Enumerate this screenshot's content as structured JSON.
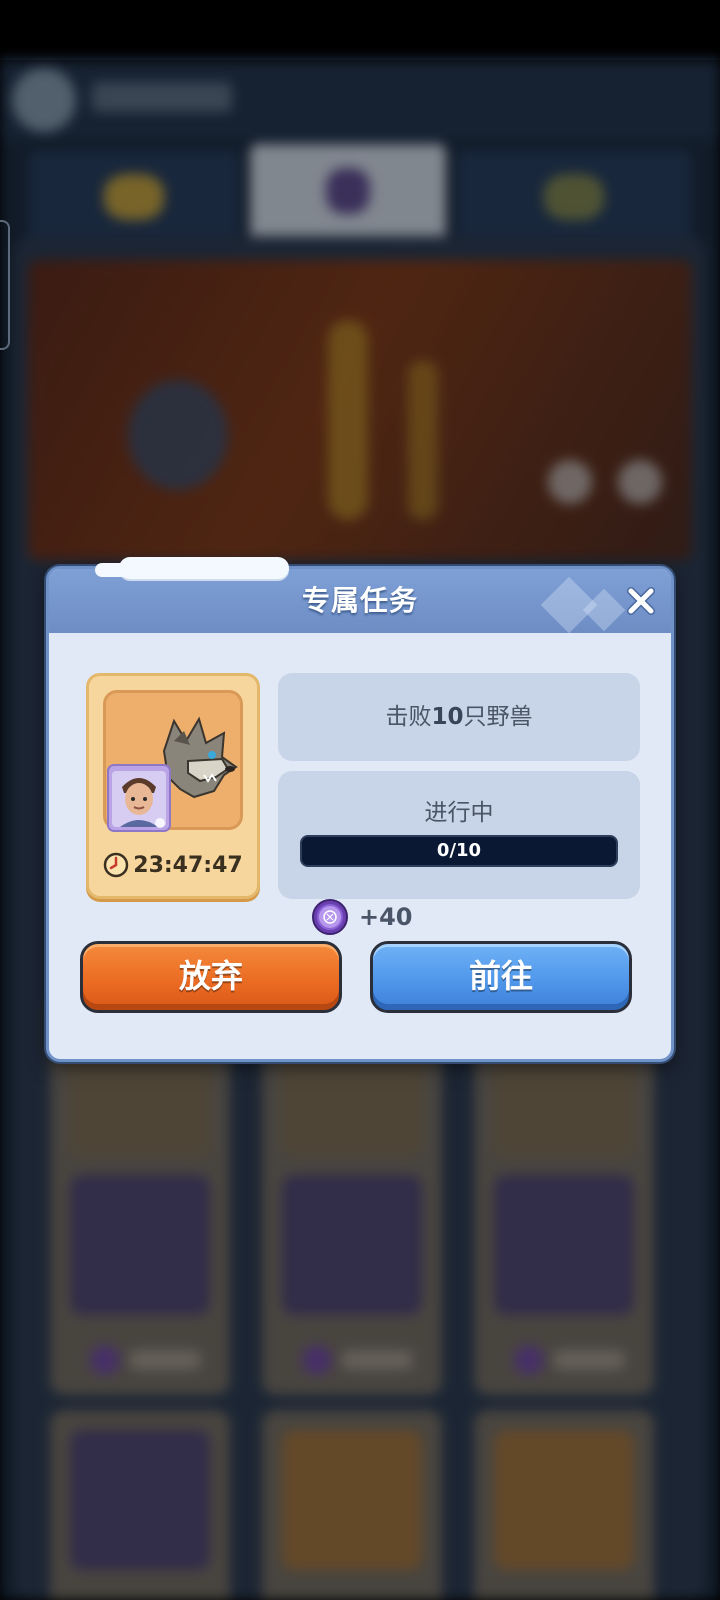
{
  "dialog": {
    "title": "专属任务",
    "task_prefix": "击败",
    "task_count": "10",
    "task_suffix": "只野兽",
    "status": "进行中",
    "progress_text": "0/10",
    "progress_value": 0,
    "progress_max": 10,
    "timer": "23:47:47",
    "reward": "+40",
    "abandon_label": "放弃",
    "go_label": "前往"
  },
  "icons": {
    "close": "close-icon",
    "clock": "clock-icon",
    "reward": "purple-coin-icon",
    "beast": "wolf-beast-icon",
    "hero": "hero-portrait-icon"
  },
  "colors": {
    "abandon": "#ea6a22",
    "go": "#4e95ea",
    "dialog_bg": "#e1e9f6",
    "header": "#7296cc"
  }
}
